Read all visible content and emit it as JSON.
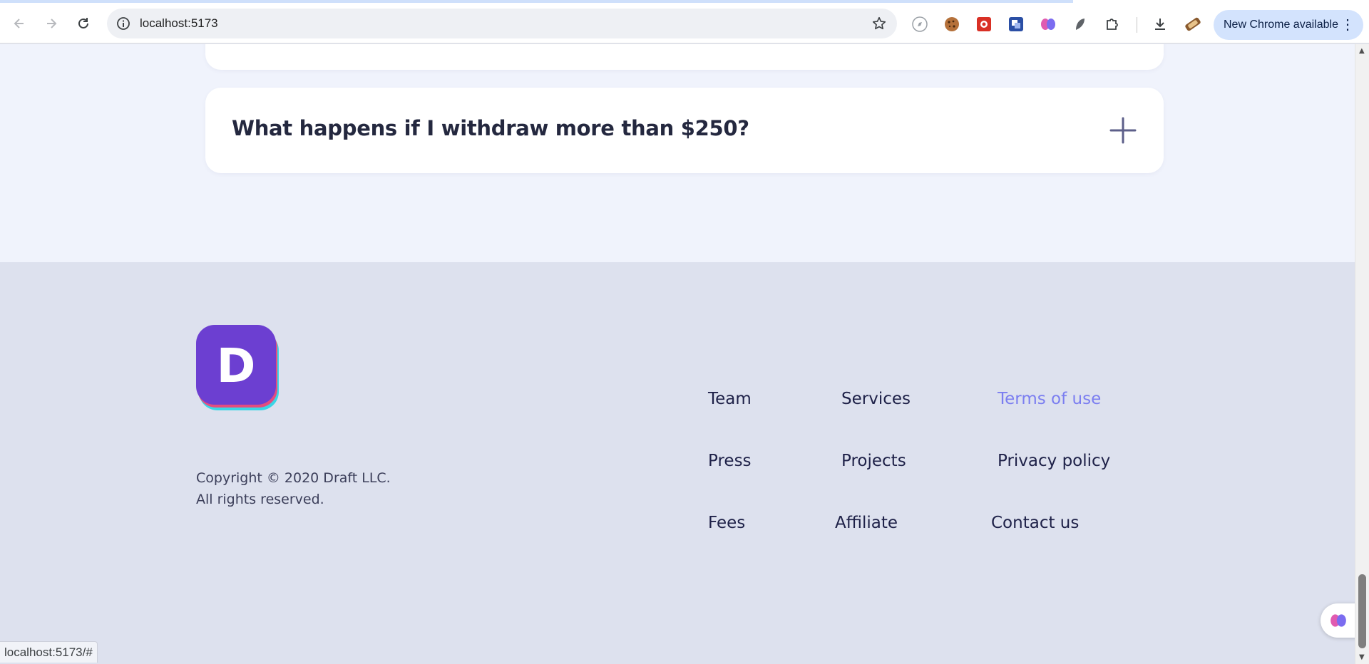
{
  "browser": {
    "url": "localhost:5173",
    "update_label": "New Chrome available",
    "status_url": "localhost:5173/#"
  },
  "faq": {
    "question": "What happens if I withdraw more than $250?"
  },
  "footer": {
    "logo_letter": "D",
    "copyright_line1": "Copyright © 2020 Draft LLC.",
    "copyright_line2": "All rights reserved.",
    "links": [
      "Team",
      "Services",
      "Terms of use",
      "Press",
      "Projects",
      "Privacy policy",
      "Fees",
      "Affiliate",
      "Contact us"
    ],
    "active_link": "Terms of use"
  },
  "colors": {
    "brand": "#6c3fd1",
    "link_active": "#7b7ef0",
    "footer_bg": "#dde1ee",
    "section_bg": "#f0f3fc"
  }
}
